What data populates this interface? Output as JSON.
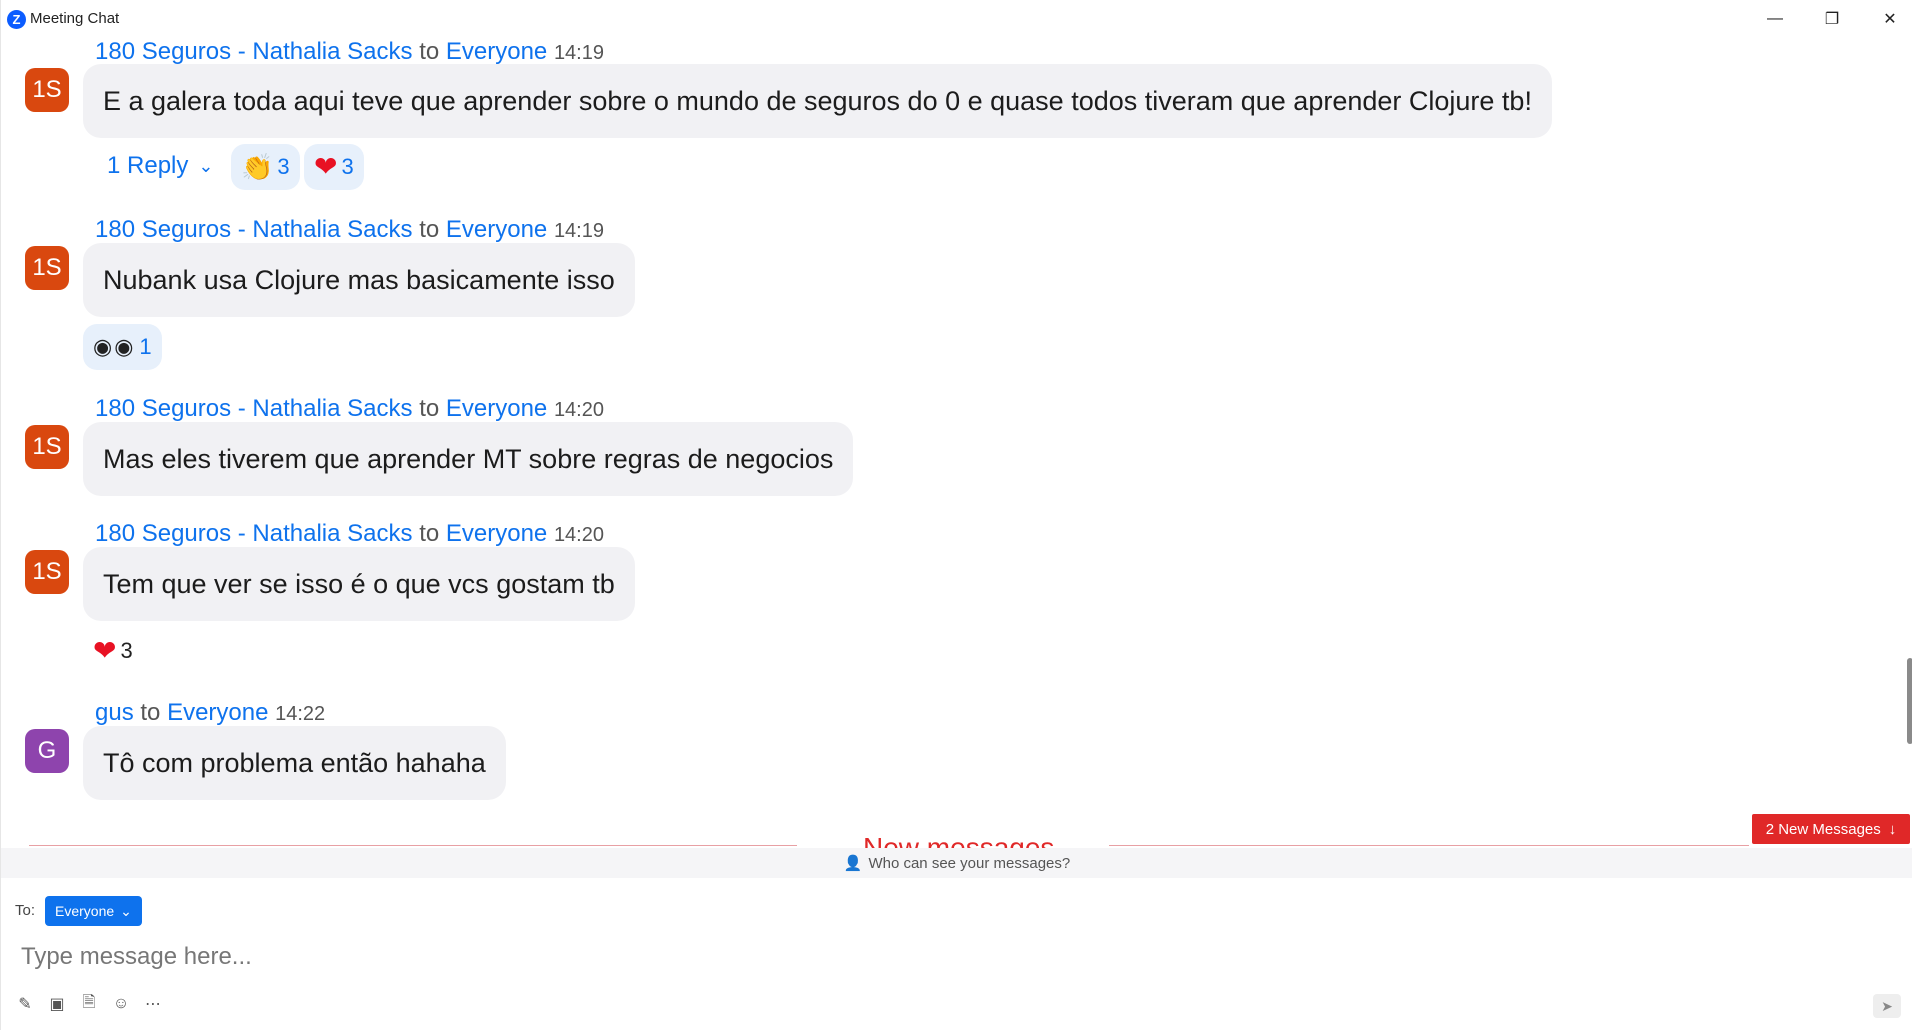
{
  "window": {
    "title": "Meeting Chat",
    "app_icon": "Z"
  },
  "messages": [
    {
      "sender": "180 Seguros - Nathalia Sacks",
      "to_word": "to",
      "recipient": "Everyone",
      "time": "14:19",
      "avatar": "1S",
      "avatar_color": "#d9480f",
      "text": "E a galera toda aqui teve que aprender sobre o mundo de seguros do 0 e quase todos tiveram que aprender Clojure tb!",
      "reply_label": "1 Reply",
      "reactions": [
        {
          "icon": "clapping-hands-icon",
          "count": "3"
        },
        {
          "icon": "heart-icon",
          "count": "3"
        }
      ]
    },
    {
      "sender": "180 Seguros - Nathalia Sacks",
      "to_word": "to",
      "recipient": "Everyone",
      "time": "14:19",
      "avatar": "1S",
      "avatar_color": "#d9480f",
      "text": "Nubank usa Clojure mas basicamente isso",
      "reactions": [
        {
          "icon": "eyes-icon",
          "count": "1"
        }
      ]
    },
    {
      "sender": "180 Seguros - Nathalia Sacks",
      "to_word": "to",
      "recipient": "Everyone",
      "time": "14:20",
      "avatar": "1S",
      "avatar_color": "#d9480f",
      "text": "Mas eles tiverem que aprender MT sobre regras de negocios"
    },
    {
      "sender": "180 Seguros - Nathalia Sacks",
      "to_word": "to",
      "recipient": "Everyone",
      "time": "14:20",
      "avatar": "1S",
      "avatar_color": "#d9480f",
      "text": "Tem que ver se isso é o que vcs gostam tb",
      "reactions": [
        {
          "icon": "heart-icon",
          "count": "3"
        }
      ]
    },
    {
      "sender": "gus",
      "to_word": "to",
      "recipient": "Everyone",
      "time": "14:22",
      "avatar": "G",
      "avatar_color": "#8e44ad",
      "text": "Tô com problema então hahaha"
    }
  ],
  "new_messages": {
    "divider_label": "New messages",
    "button_label": "2 New Messages"
  },
  "composer": {
    "visibility_text": "Who can see your messages?",
    "to_label": "To:",
    "to_value": "Everyone",
    "placeholder": "Type message here..."
  },
  "accent_color": "#0e72ed",
  "alert_color": "#e02828"
}
